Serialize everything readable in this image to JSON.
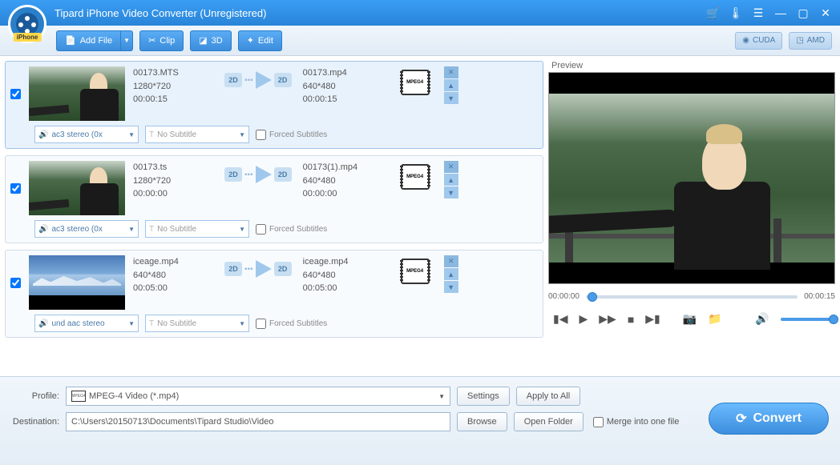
{
  "title": "Tipard iPhone Video Converter (Unregistered)",
  "logo_badge": "iPhone",
  "toolbar": {
    "add_file": "Add File",
    "clip": "Clip",
    "three_d": "3D",
    "edit": "Edit",
    "cuda": "CUDA",
    "amd": "AMD"
  },
  "preview": {
    "label": "Preview",
    "time_start": "00:00:00",
    "time_end": "00:00:15"
  },
  "files": [
    {
      "selected": true,
      "src_name": "00173.MTS",
      "src_res": "1280*720",
      "src_dur": "00:00:15",
      "out_name": "00173.mp4",
      "out_res": "640*480",
      "out_dur": "00:00:15",
      "format_label": "MPEG4",
      "audio": "ac3 stereo (0x",
      "subtitle": "No Subtitle",
      "forced": "Forced Subtitles",
      "thumb": "forest"
    },
    {
      "selected": false,
      "src_name": "00173.ts",
      "src_res": "1280*720",
      "src_dur": "00:00:00",
      "out_name": "00173(1).mp4",
      "out_res": "640*480",
      "out_dur": "00:00:00",
      "format_label": "MPEG4",
      "audio": "ac3 stereo (0x",
      "subtitle": "No Subtitle",
      "forced": "Forced Subtitles",
      "thumb": "forest"
    },
    {
      "selected": false,
      "src_name": "iceage.mp4",
      "src_res": "640*480",
      "src_dur": "00:05:00",
      "out_name": "iceage.mp4",
      "out_res": "640*480",
      "out_dur": "00:05:00",
      "format_label": "MPEG4",
      "audio": "und aac stereo",
      "subtitle": "No Subtitle",
      "forced": "Forced Subtitles",
      "thumb": "ice"
    }
  ],
  "bottom": {
    "profile_label": "Profile:",
    "profile_value": "MPEG-4 Video (*.mp4)",
    "profile_icon": "MPEG4",
    "settings": "Settings",
    "apply_all": "Apply to All",
    "destination_label": "Destination:",
    "destination_value": "C:\\Users\\20150713\\Documents\\Tipard Studio\\Video",
    "browse": "Browse",
    "open_folder": "Open Folder",
    "merge": "Merge into one file",
    "convert": "Convert"
  }
}
